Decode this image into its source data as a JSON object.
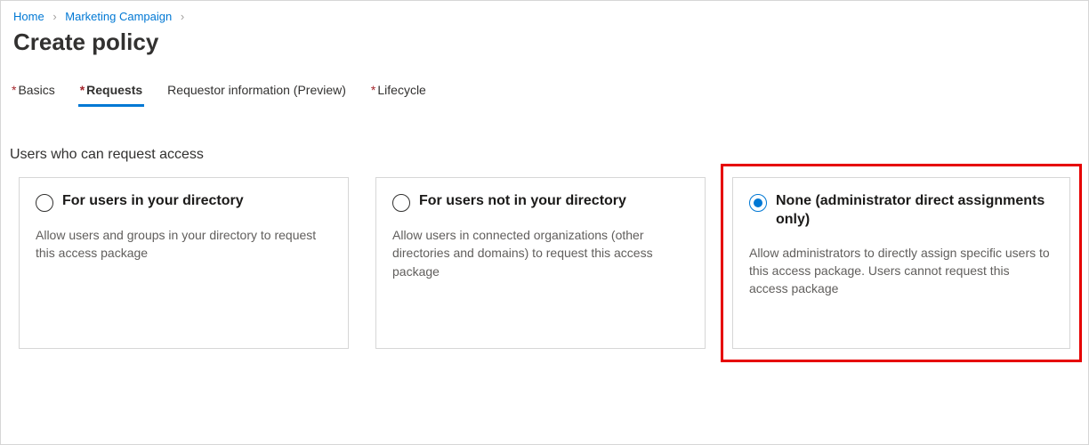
{
  "breadcrumb": {
    "items": [
      {
        "label": "Home"
      },
      {
        "label": "Marketing Campaign"
      }
    ]
  },
  "page_title": "Create policy",
  "tabs": [
    {
      "label": "Basics",
      "required": true,
      "active": false
    },
    {
      "label": "Requests",
      "required": true,
      "active": true
    },
    {
      "label": "Requestor information (Preview)",
      "required": false,
      "active": false
    },
    {
      "label": "Lifecycle",
      "required": true,
      "active": false
    }
  ],
  "section_label": "Users who can request access",
  "cards": [
    {
      "title": "For users in your directory",
      "desc": "Allow users and groups in your directory to request this access package",
      "selected": false
    },
    {
      "title": "For users not in your directory",
      "desc": "Allow users in connected organizations (other directories and domains) to request this access package",
      "selected": false
    },
    {
      "title": "None (administrator direct assignments only)",
      "desc": "Allow administrators to directly assign specific users to this access package. Users cannot request this access package",
      "selected": true
    }
  ]
}
